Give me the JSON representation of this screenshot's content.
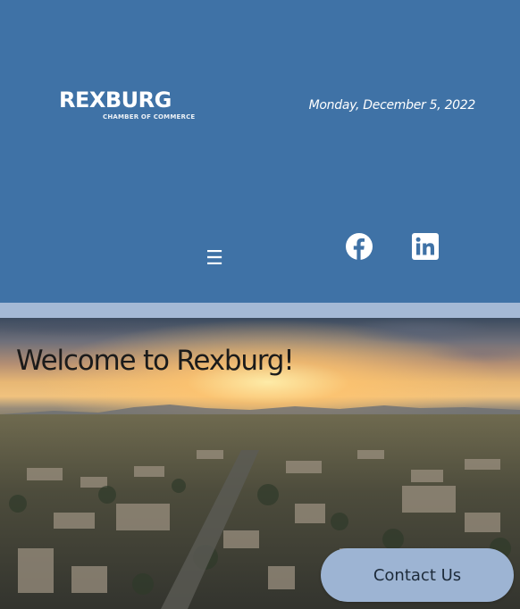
{
  "header": {
    "logo": {
      "name": "REXBURG",
      "tagline": "CHAMBER OF COMMERCE"
    },
    "date": "Monday, December 5, 2022",
    "menu_icon": "hamburger-menu-icon",
    "menu_glyph": "☰",
    "social": [
      {
        "name": "facebook",
        "icon": "facebook-icon"
      },
      {
        "name": "linkedin",
        "icon": "linkedin-icon"
      }
    ]
  },
  "hero": {
    "title": "Welcome to Rexburg!"
  },
  "contact": {
    "label": "Contact Us"
  },
  "colors": {
    "header_bg": "#3f72a6",
    "divider": "#a4b9d5",
    "button_bg": "#9db4d3",
    "text_light": "#ffffff"
  }
}
